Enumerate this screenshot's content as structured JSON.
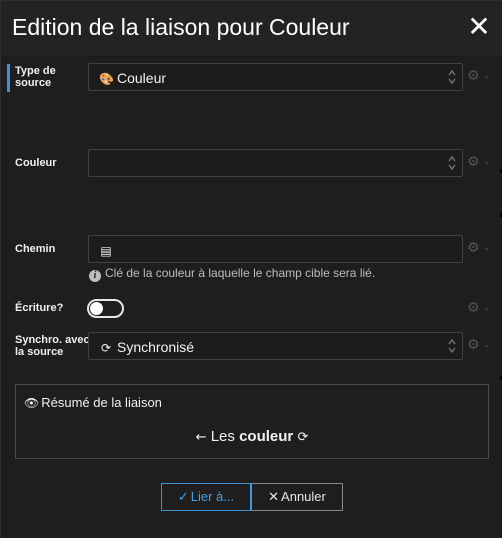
{
  "dialog": {
    "title": "Edition de la liaison pour Couleur",
    "close_icon": "close-icon"
  },
  "fields": {
    "source_type": {
      "label_line1": "Type de",
      "label_line2": "source",
      "value": "Couleur",
      "icon": "palette-icon"
    },
    "color": {
      "label": "Couleur",
      "value": ""
    },
    "path": {
      "label": "Chemin",
      "value": "",
      "icon": "list-icon",
      "hint": "Clé de la couleur à laquelle le champ cible sera lié.",
      "hint_icon": "info-icon"
    },
    "write": {
      "label": "Écriture?",
      "enabled": false
    },
    "sync": {
      "label_line1": "Synchro. avec",
      "label_line2": "la source",
      "value": "Synchronisé",
      "icon": "sync-icon"
    }
  },
  "summary": {
    "title": "Résumé de la liaison",
    "icon": "eye-icon",
    "prefix": "Les",
    "bold": "couleur"
  },
  "buttons": {
    "ok": "Lier à...",
    "cancel": "Annuler"
  },
  "colors": {
    "accent": "#3a93d6",
    "background": "#1e1e1e",
    "header": "#232323"
  }
}
